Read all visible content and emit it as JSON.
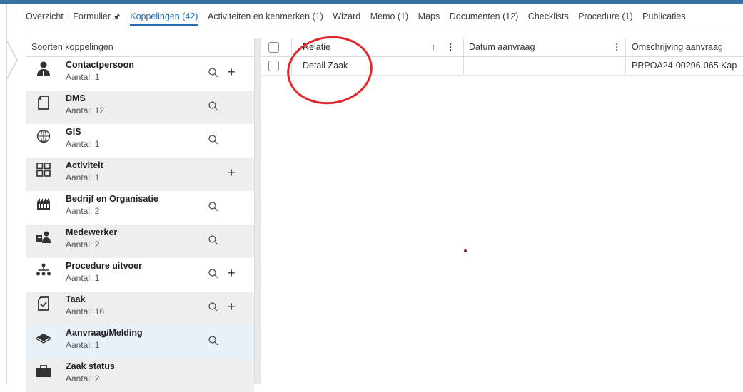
{
  "tabs": [
    {
      "label": "Overzicht",
      "active": false
    },
    {
      "label": "Formulier",
      "active": false
    },
    {
      "label": "Koppelingen (42)",
      "active": true
    },
    {
      "label": "Activiteiten en kenmerken (1)",
      "active": false
    },
    {
      "label": "Wizard",
      "active": false
    },
    {
      "label": "Memo (1)",
      "active": false
    },
    {
      "label": "Maps",
      "active": false
    },
    {
      "label": "Documenten (12)",
      "active": false
    },
    {
      "label": "Checklists",
      "active": false
    },
    {
      "label": "Procedure (1)",
      "active": false
    },
    {
      "label": "Publicaties",
      "active": false
    }
  ],
  "sidebar": {
    "header": "Soorten koppelingen",
    "items": [
      {
        "name": "Contactpersoon",
        "count": "Aantal: 1",
        "icon": "person-icon",
        "search": true,
        "add": true
      },
      {
        "name": "DMS",
        "count": "Aantal: 12",
        "icon": "document-icon",
        "search": true,
        "add": false
      },
      {
        "name": "GIS",
        "count": "Aantal: 1",
        "icon": "globe-icon",
        "search": true,
        "add": false
      },
      {
        "name": "Activiteit",
        "count": "Aantal: 1",
        "icon": "grid-icon",
        "search": false,
        "add": true
      },
      {
        "name": "Bedrijf en Organisatie",
        "count": "Aantal: 2",
        "icon": "factory-icon",
        "search": true,
        "add": false
      },
      {
        "name": "Medewerker",
        "count": "Aantal: 2",
        "icon": "employee-icon",
        "search": true,
        "add": false
      },
      {
        "name": "Procedure uitvoer",
        "count": "Aantal: 1",
        "icon": "hierarchy-icon",
        "search": true,
        "add": true
      },
      {
        "name": "Taak",
        "count": "Aantal: 16",
        "icon": "task-icon",
        "search": true,
        "add": true
      },
      {
        "name": "Aanvraag/Melding",
        "count": "Aantal: 1",
        "icon": "book-icon",
        "search": true,
        "add": false
      },
      {
        "name": "Zaak status",
        "count": "Aantal: 2",
        "icon": "briefcase-icon",
        "search": false,
        "add": false
      }
    ]
  },
  "grid": {
    "columns": [
      "Relatie",
      "Datum aanvraag",
      "Omschrijving aanvraag"
    ],
    "rows": [
      {
        "relatie": "Detail Zaak",
        "datum": "",
        "omschrijving": "PRPOA24-00296-065 Kap"
      }
    ]
  },
  "colors": {
    "accent": "#2b6cb0",
    "topbar": "#3d6fa3",
    "annotation": "#e3262b"
  }
}
